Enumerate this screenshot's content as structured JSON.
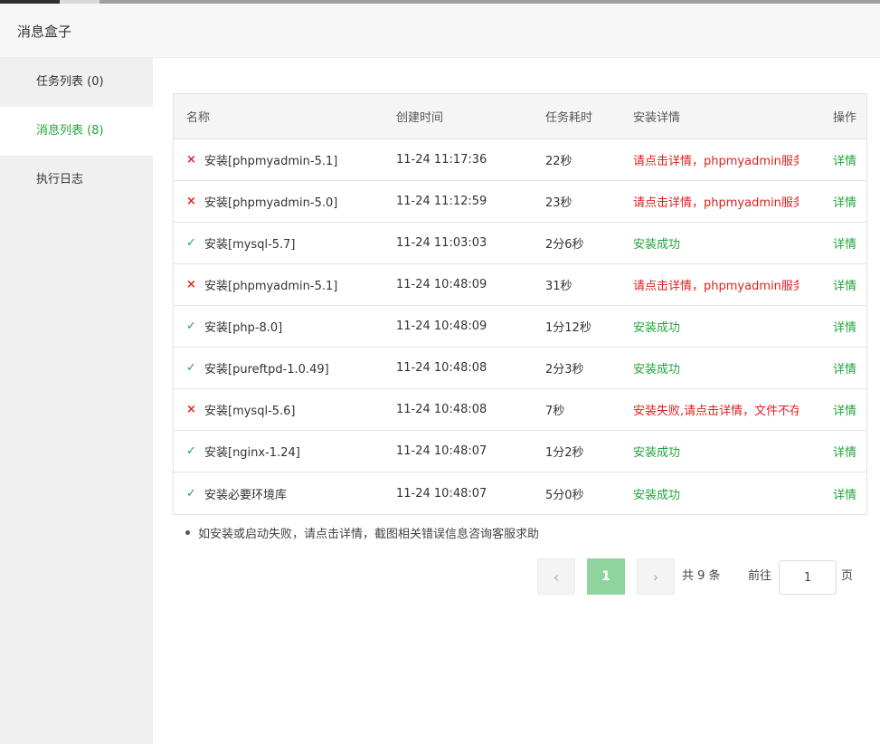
{
  "header": {
    "title": "消息盒子"
  },
  "sidebar": {
    "items": [
      {
        "label": "任务列表 (0)"
      },
      {
        "label": "消息列表 (8)"
      },
      {
        "label": "执行日志"
      }
    ]
  },
  "table": {
    "columns": [
      "名称",
      "创建时间",
      "任务耗时",
      "安装详情",
      "操作"
    ],
    "rows": [
      {
        "status": "fail",
        "icon": "×",
        "name": "安装[phpmyadmin-5.1]",
        "time": "11-24 11:17:36",
        "cost": "22秒",
        "detail": "请点击详情，phpmyadmin服务",
        "op": "详情"
      },
      {
        "status": "fail",
        "icon": "×",
        "name": "安装[phpmyadmin-5.0]",
        "time": "11-24 11:12:59",
        "cost": "23秒",
        "detail": "请点击详情，phpmyadmin服务",
        "op": "详情"
      },
      {
        "status": "ok",
        "icon": "✓",
        "name": "安装[mysql-5.7]",
        "time": "11-24 11:03:03",
        "cost": "2分6秒",
        "detail": "安装成功",
        "op": "详情"
      },
      {
        "status": "fail",
        "icon": "×",
        "name": "安装[phpmyadmin-5.1]",
        "time": "11-24 10:48:09",
        "cost": "31秒",
        "detail": "请点击详情，phpmyadmin服务",
        "op": "详情"
      },
      {
        "status": "ok",
        "icon": "✓",
        "name": "安装[php-8.0]",
        "time": "11-24 10:48:09",
        "cost": "1分12秒",
        "detail": "安装成功",
        "op": "详情"
      },
      {
        "status": "ok",
        "icon": "✓",
        "name": "安装[pureftpd-1.0.49]",
        "time": "11-24 10:48:08",
        "cost": "2分3秒",
        "detail": "安装成功",
        "op": "详情"
      },
      {
        "status": "fail",
        "icon": "×",
        "name": "安装[mysql-5.6]",
        "time": "11-24 10:48:08",
        "cost": "7秒",
        "detail": "安装失败,请点击详情，文件不存",
        "op": "详情"
      },
      {
        "status": "ok",
        "icon": "✓",
        "name": "安装[nginx-1.24]",
        "time": "11-24 10:48:07",
        "cost": "1分2秒",
        "detail": "安装成功",
        "op": "详情"
      },
      {
        "status": "ok",
        "icon": "✓",
        "name": "安装必要环境库",
        "time": "11-24 10:48:07",
        "cost": "5分0秒",
        "detail": "安装成功",
        "op": "详情"
      }
    ]
  },
  "tip": "如安装或启动失败，请点击详情，截图相关错误信息咨询客服求助",
  "pager": {
    "prev": "‹",
    "current": "1",
    "next": "›",
    "total": "共 9 条",
    "goto_label": "前往",
    "page_value": "1",
    "page_suffix": "页"
  },
  "colors": {
    "accent": "#20a53a",
    "error": "#e02020",
    "active_page": "#8fd49f"
  }
}
